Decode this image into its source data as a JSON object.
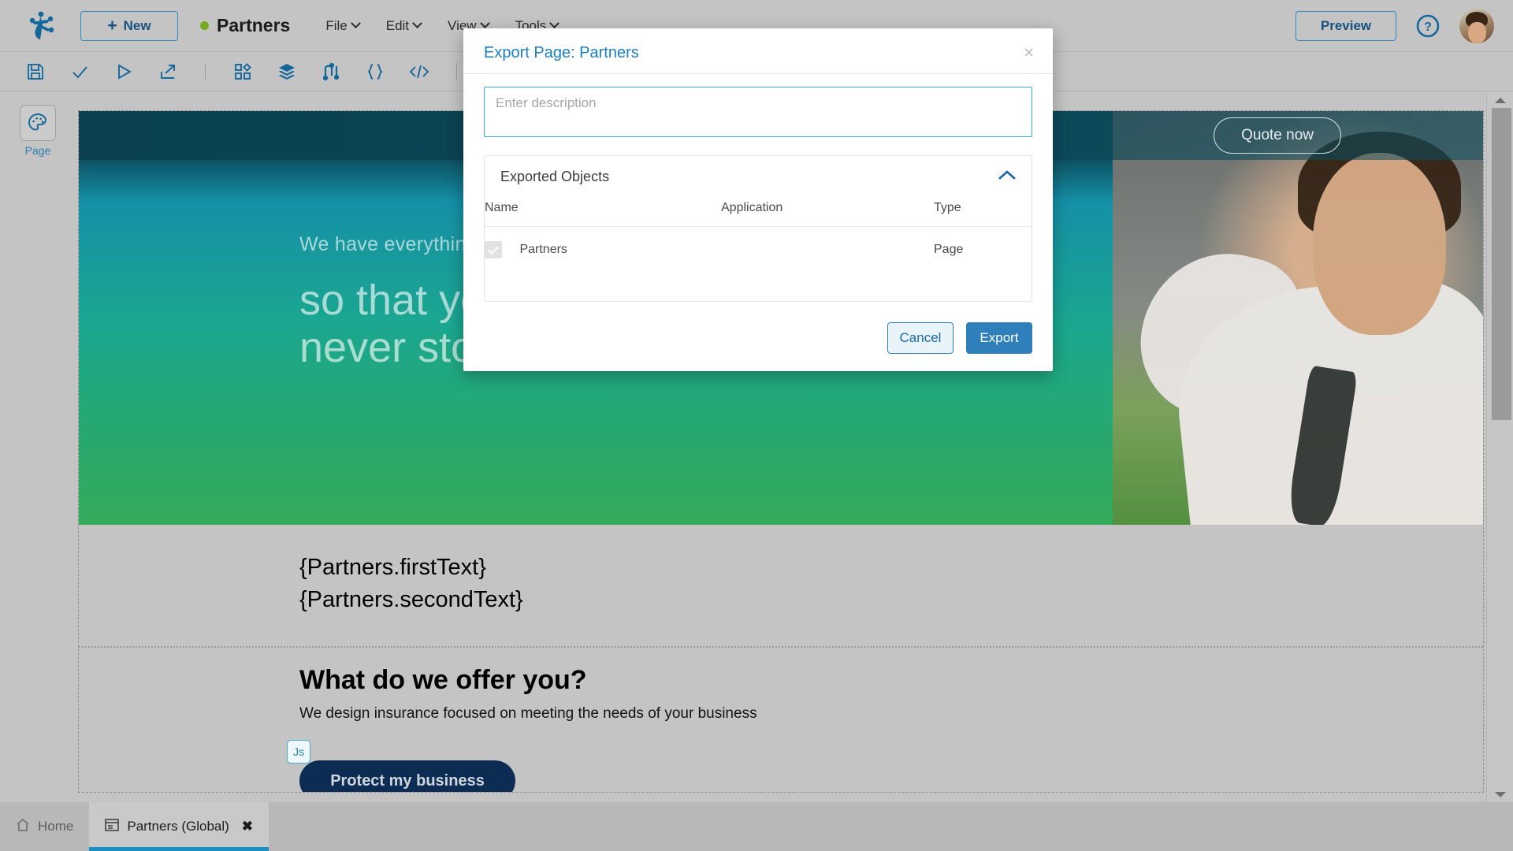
{
  "app": {
    "logo_icon": "frog-footprint-logo",
    "new_button": {
      "label": "New",
      "icon": "plus-icon"
    },
    "page_name": "Partners",
    "status_dot_color": "#77ab1f",
    "menus": [
      "File",
      "Edit",
      "View",
      "Tools"
    ],
    "preview_button": "Preview",
    "help_icon": "question-circle-icon",
    "avatar": "user-avatar"
  },
  "toolbar": {
    "items": [
      {
        "name": "save-icon",
        "title": "Save"
      },
      {
        "name": "check-icon",
        "title": "Validate"
      },
      {
        "name": "play-icon",
        "title": "Run"
      },
      {
        "name": "export-icon",
        "title": "Export"
      },
      {
        "name": "widgets-icon",
        "title": "Widgets"
      },
      {
        "name": "layers-icon",
        "title": "Layers"
      },
      {
        "name": "flows-icon",
        "title": "Flows"
      },
      {
        "name": "braces-icon",
        "title": "Variables"
      },
      {
        "name": "code-icon",
        "title": "Code"
      }
    ]
  },
  "left_rail": {
    "items": [
      {
        "label": "Page",
        "icon": "palette-icon"
      }
    ]
  },
  "canvas": {
    "hero": {
      "quote_button": "Quote now",
      "subtitle": "We have everything covered",
      "title_line1": "so that your business",
      "title_line2": "never stops"
    },
    "tokens": [
      "{Partners.firstText}",
      "{Partners.secondText}"
    ],
    "offer": {
      "title": "What do we offer you?",
      "subtitle": "We design insurance focused on meeting the needs of your business"
    },
    "cta": {
      "js_badge": "Js",
      "button_label": "Protect my business"
    }
  },
  "bottom_tabs": [
    {
      "label": "Home",
      "icon": "home-icon",
      "active": false,
      "closable": false
    },
    {
      "label": "Partners (Global)",
      "icon": "page-icon",
      "active": true,
      "closable": true,
      "close_glyph": "✖"
    }
  ],
  "modal": {
    "title": "Export Page: Partners",
    "close_glyph": "×",
    "description": {
      "value": "",
      "placeholder": "Enter description"
    },
    "panel": {
      "title": "Exported Objects",
      "collapse_icon": "chevron-up-icon",
      "columns": [
        "Name",
        "Application",
        "Type"
      ],
      "rows": [
        {
          "checked": true,
          "checkbox_disabled": true,
          "name": "Partners",
          "application": "",
          "type": "Page"
        }
      ]
    },
    "actions": {
      "cancel": "Cancel",
      "export": "Export"
    }
  },
  "colors": {
    "accent_blue": "#1a7fc1",
    "primary_button": "#2f7fba",
    "chrome_gray": "#c4c4c4",
    "hero_teal": "#0c4d5e",
    "hero_green": "#35ab5b",
    "cta_navy": "#0d2c54",
    "active_tab_underline": "#1a8fc1"
  }
}
